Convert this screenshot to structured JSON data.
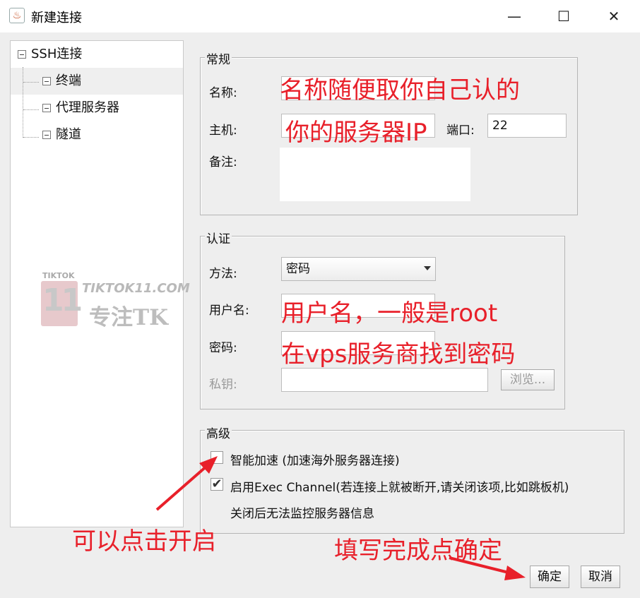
{
  "window": {
    "title": "新建连接",
    "minimize": "—",
    "maximize": "☐",
    "close": "✕"
  },
  "tree": {
    "root": "SSH连接",
    "children": [
      "终端",
      "代理服务器",
      "隧道"
    ]
  },
  "general": {
    "title": "常规",
    "name_label": "名称:",
    "name_value": "",
    "host_label": "主机:",
    "host_value": "",
    "port_label": "端口:",
    "port_value": "22",
    "note_label": "备注:",
    "note_value": ""
  },
  "auth": {
    "title": "认证",
    "method_label": "方法:",
    "method_value": "密码",
    "user_label": "用户名:",
    "user_value": "",
    "password_label": "密码:",
    "password_value": "",
    "key_label": "私钥:",
    "key_value": "",
    "browse_label": "浏览..."
  },
  "advanced": {
    "title": "高级",
    "smart_accel_label": "智能加速 (加速海外服务器连接)",
    "smart_accel_checked": false,
    "exec_channel_label": "启用Exec Channel(若连接上就被断开,请关闭该项,比如跳板机)",
    "exec_channel_checked": true,
    "exec_channel_note": "关闭后无法监控服务器信息"
  },
  "footer": {
    "ok_label": "确定",
    "cancel_label": "取消"
  },
  "annotations": {
    "name_hint": "名称随便取你自己认的",
    "host_hint": "你的服务器IP",
    "user_hint": "用户名，一般是root",
    "password_hint": "在vps服务商找到密码",
    "click_hint": "可以点击开启",
    "confirm_hint": "填写完成点确定",
    "color": "#e8202a"
  },
  "watermark": {
    "top": "TIKTOK",
    "number": "11",
    "url": "TIKTOK11.COM",
    "sub": "专注TK"
  }
}
